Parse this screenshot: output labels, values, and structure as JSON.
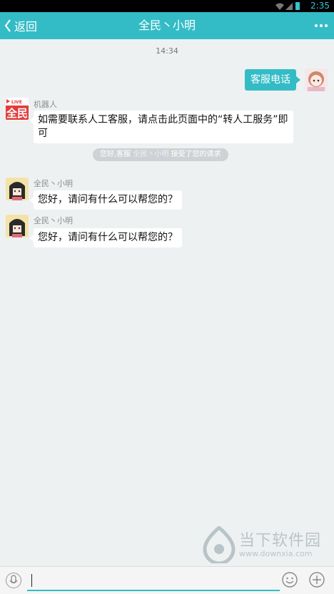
{
  "status_bar": {
    "time": "2:35"
  },
  "nav": {
    "back_label": "返回",
    "title": "全民丶小明"
  },
  "chat": {
    "timestamp": "14:34",
    "outgoing": {
      "text": "客服电话"
    },
    "robot": {
      "name": "机器人",
      "logo_text": "全民",
      "logo_badge": "LIVE",
      "message_line1": "如需要联系人工客服，请点击此页面中的“转人工服务”即",
      "message_line2": "可"
    },
    "system": {
      "prefix": "您好,客服 ",
      "agent": "全民丶小明",
      "suffix": " 接受了您的请求"
    },
    "agent_messages": [
      {
        "name": "全民丶小明",
        "text": "您好，请问有什么可以帮您的？"
      },
      {
        "name": "全民丶小明",
        "text": "您好，请问有什么可以帮您的？"
      }
    ]
  },
  "input": {
    "value": ""
  },
  "watermark": {
    "title": "当下软件园",
    "url": "www.downxia.com"
  },
  "colors": {
    "accent": "#34bcc6",
    "background": "#eef1f2"
  }
}
